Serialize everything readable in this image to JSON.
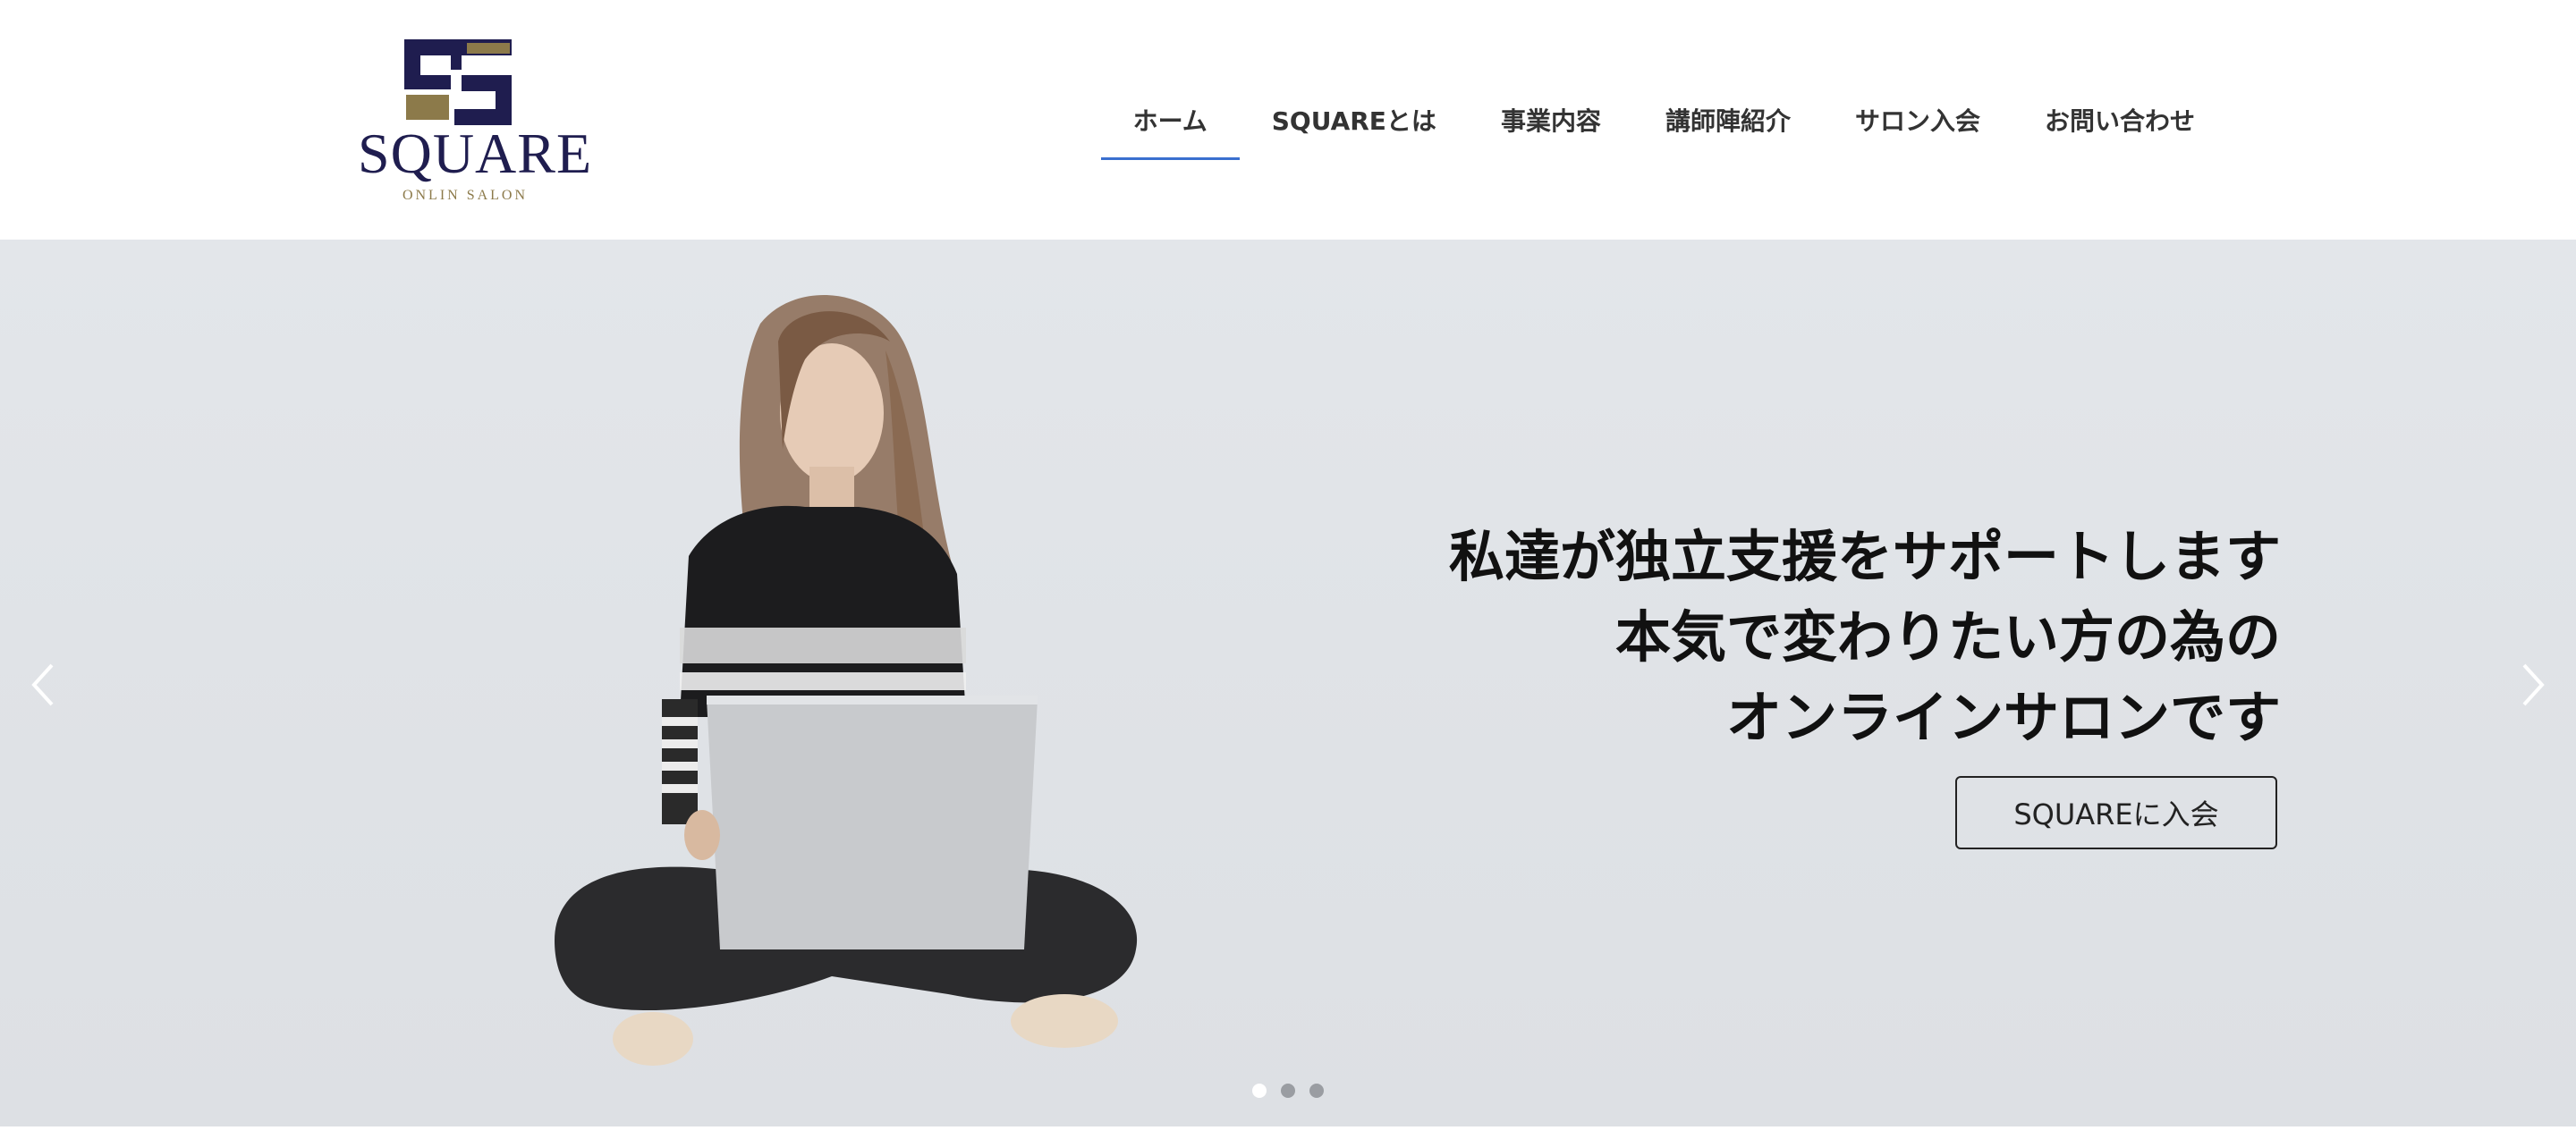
{
  "brand": {
    "name": "SQUARE",
    "tagline": "ONLIN SALON",
    "colors": {
      "navy": "#1f1d4f",
      "gold": "#8c7a4a"
    }
  },
  "nav": {
    "items": [
      {
        "label": "ホーム",
        "active": true
      },
      {
        "label": "SQUAREとは",
        "active": false
      },
      {
        "label": "事業内容",
        "active": false
      },
      {
        "label": "講師陣紹介",
        "active": false
      },
      {
        "label": "サロン入会",
        "active": false
      },
      {
        "label": "お問い合わせ",
        "active": false
      }
    ],
    "active_color": "#3a6fcf"
  },
  "hero": {
    "headline": [
      "私達が独立支援をサポートします",
      "本気で変わりたい方の為の",
      "オンラインサロンです"
    ],
    "cta_label": "SQUAREに入会",
    "prev_icon": "chevron-left-icon",
    "next_icon": "chevron-right-icon",
    "slides_total": 3,
    "current_slide": 1
  }
}
